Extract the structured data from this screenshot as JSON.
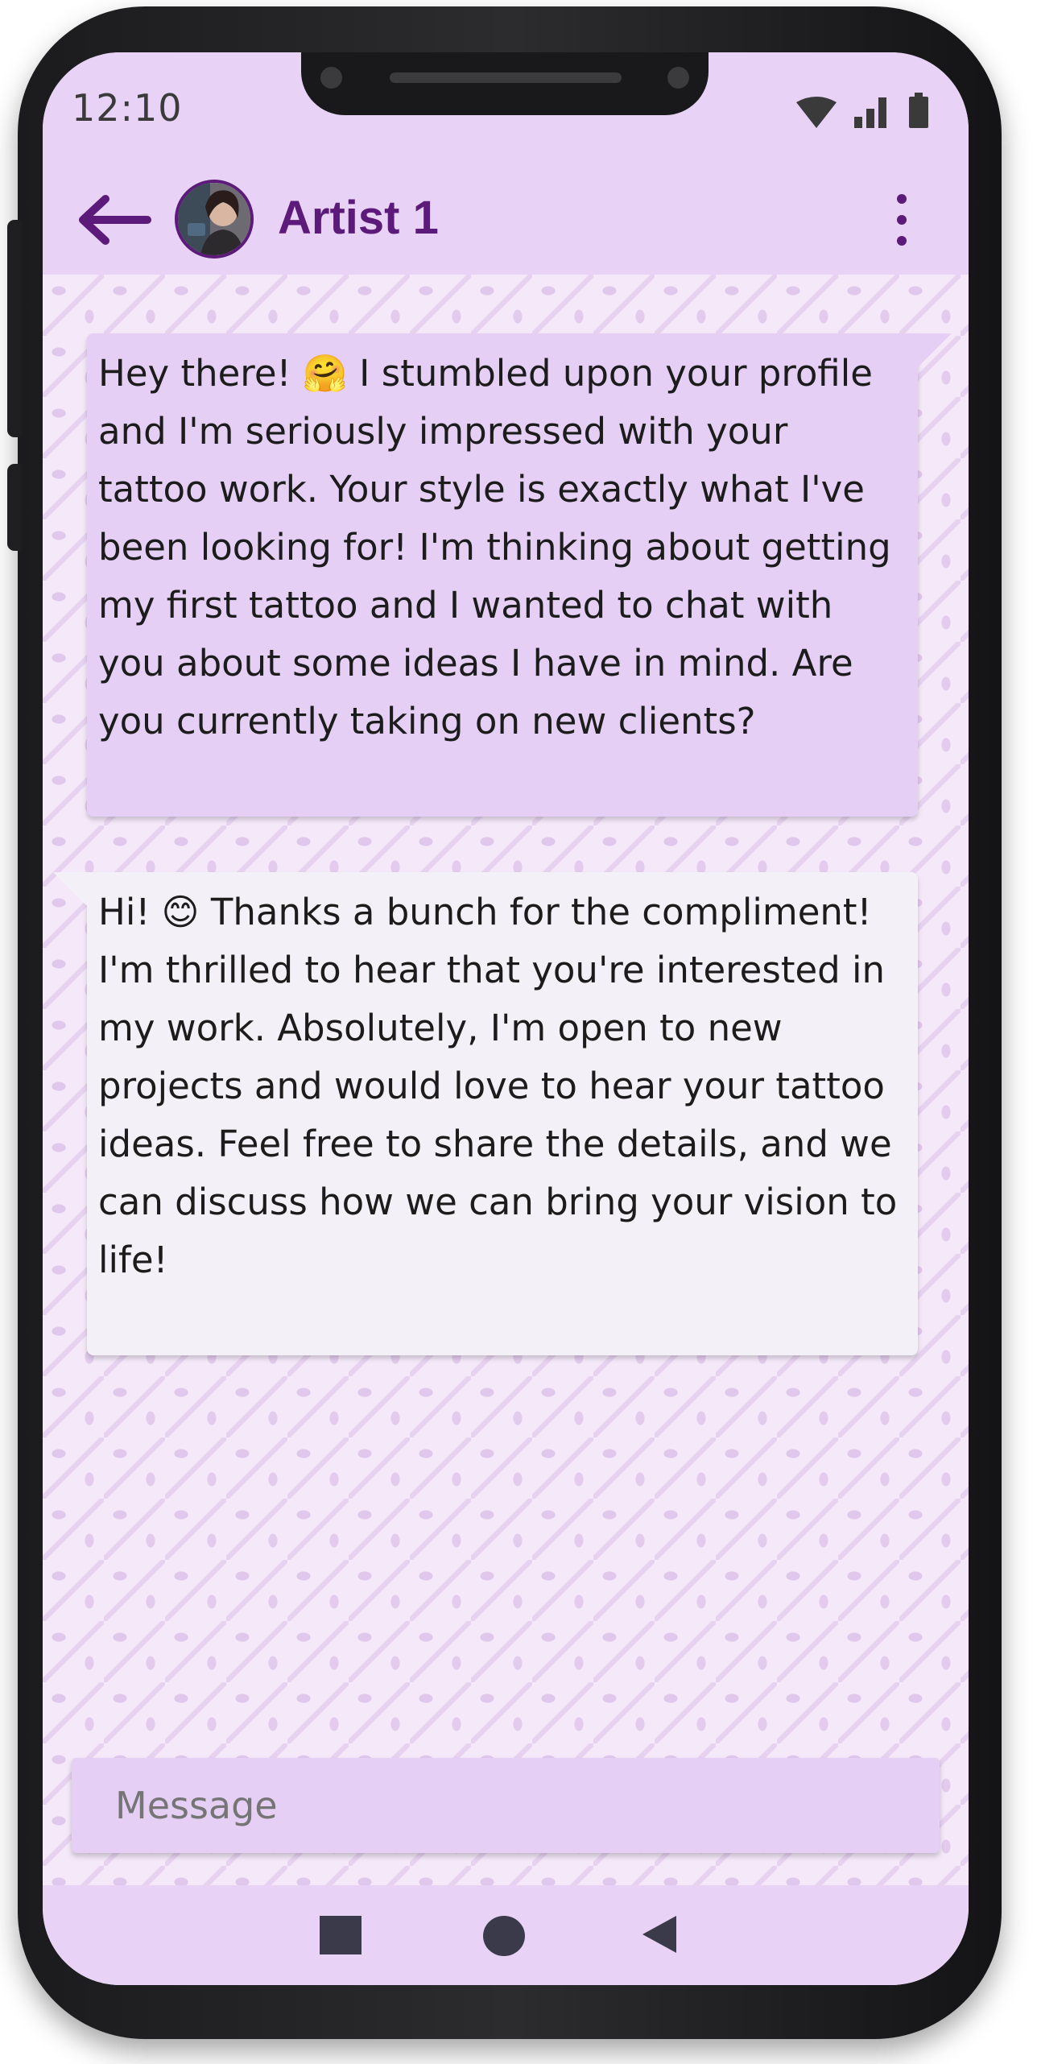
{
  "status_bar": {
    "time": "12:10",
    "icons": [
      "wifi-icon",
      "signal-icon",
      "battery-icon"
    ]
  },
  "app_bar": {
    "title": "Artist 1",
    "back_icon": "arrow-left-icon",
    "avatar": "artist-avatar",
    "menu_icon": "more-vertical-icon"
  },
  "messages": [
    {
      "direction": "outgoing",
      "text": "Hey there! 🤗 I stumbled upon your profile and I'm seriously impressed with your tattoo work. Your style is exactly what I've been looking for! I'm thinking about getting my first tattoo and I wanted to chat with you about some ideas I have in mind. Are you currently taking on new clients?"
    },
    {
      "direction": "incoming",
      "text": "Hi! 😊 Thanks a bunch for the compliment! I'm thrilled to hear that you're interested in my work. Absolutely, I'm open to new projects and would love to hear your tattoo ideas. Feel free to share the details, and we can discuss how we can bring your vision to life!"
    }
  ],
  "composer": {
    "placeholder": "Message"
  },
  "nav_bar": {
    "buttons": [
      "recents-square-icon",
      "home-circle-icon",
      "back-triangle-icon"
    ]
  },
  "colors": {
    "primary": "#5c1a7a",
    "header": "#e8d2f5",
    "outgoing_bubble": "#e6cff4",
    "incoming_bubble": "#f3f1f7",
    "chat_background": "#f4e8f9"
  }
}
